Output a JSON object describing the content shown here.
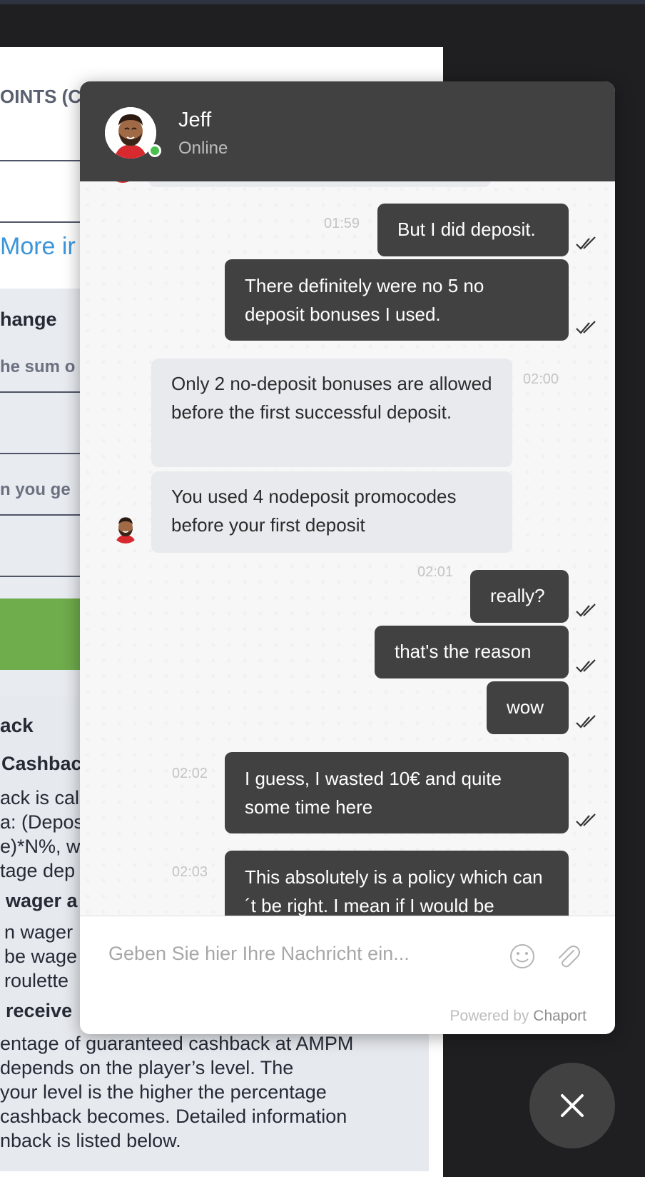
{
  "background": {
    "heading1": "OINTS (C",
    "link": "More ir",
    "change_label": "hange",
    "sum_label": "he sum o",
    "you_get_label": "n you ge",
    "cashback_heading": "ack",
    "cashback_sub": "Cashbac",
    "para1_lines": [
      "ack is cal",
      "a: (Depos",
      "e)*N%, w",
      "tage dep"
    ],
    "wager_heading": "wager a",
    "para2_lines": [
      "n wager",
      "be wage",
      "roulette"
    ],
    "receive_heading": "receive",
    "bottom_lines": [
      "entage of guaranteed cashback at AMPM",
      "depends on the player’s level. The",
      "your level is the higher the percentage",
      "cashback becomes. Detailed information",
      "nback is listed below."
    ]
  },
  "chat": {
    "agent_name": "Jeff",
    "agent_status": "Online",
    "messages": [
      {
        "text": "But I did deposit.",
        "time": "01:59"
      },
      {
        "text": "There definitely were no 5 no deposit bonuses I used."
      },
      {
        "text": "Only 2 no-deposit bonuses are allowed before the first successful deposit.",
        "time": "02:00"
      },
      {
        "text": "You used 4 nodeposit promocodes before your first deposit"
      },
      {
        "text": "really?",
        "time": "02:01"
      },
      {
        "text": "that's the reason"
      },
      {
        "text": "wow"
      },
      {
        "text": "I guess, I wasted 10€ and quite some time here",
        "time": "02:02"
      },
      {
        "text": "This absolutely is a policy which can´t be right. I mean if I would be",
        "time": "02:03"
      }
    ],
    "composer_placeholder": "Geben Sie hier Ihre Nachricht ein...",
    "powered_prefix": "Powered by",
    "powered_brand": "Chaport"
  },
  "icons": {
    "emoji": "smiley-icon",
    "attach": "paperclip-icon",
    "close": "close-icon",
    "read_receipt": "double-check-icon"
  },
  "colors": {
    "header_bg": "#414141",
    "outgoing_bubble": "#414141",
    "incoming_bubble": "#e8eaed",
    "online_dot": "#4cc04f",
    "link": "#3b95d9",
    "green_button": "#6fac4c"
  }
}
